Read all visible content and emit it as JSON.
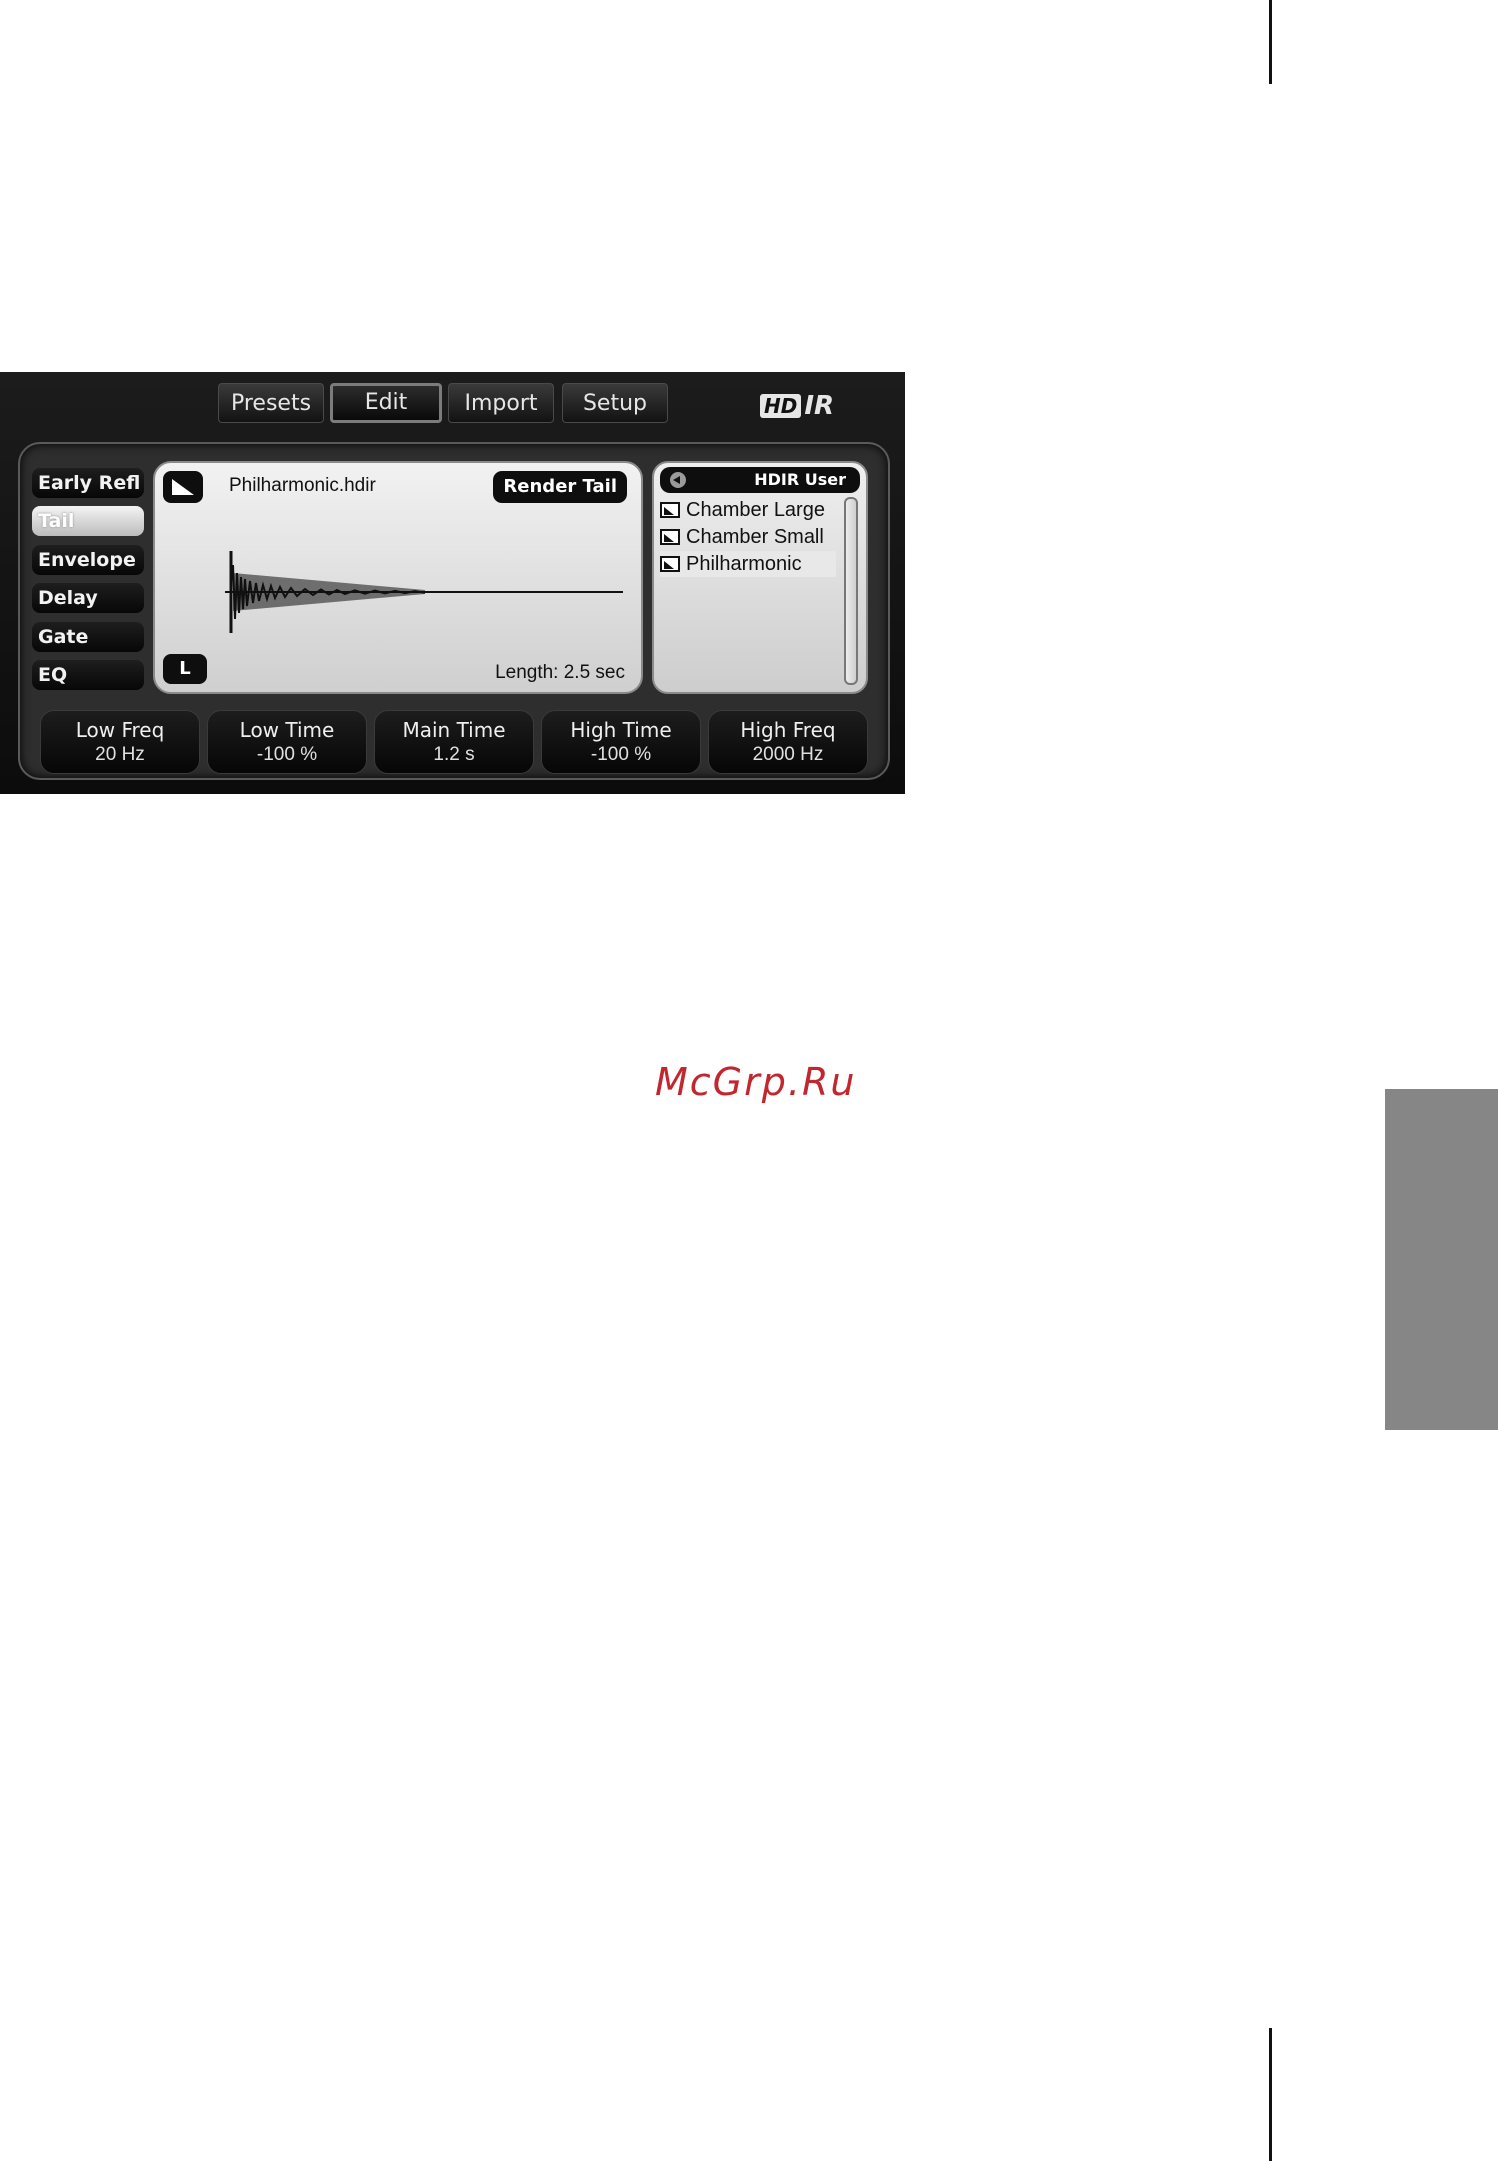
{
  "toolbar": {
    "tabs": [
      {
        "label": "Presets"
      },
      {
        "label": "Edit"
      },
      {
        "label": "Import"
      },
      {
        "label": "Setup"
      }
    ],
    "logo_hd": "HD",
    "logo_ir": "IR"
  },
  "side_nav": {
    "items": [
      {
        "label": "Early Refl"
      },
      {
        "label": "Tail"
      },
      {
        "label": "Envelope"
      },
      {
        "label": "Delay"
      },
      {
        "label": "Gate"
      },
      {
        "label": "EQ"
      }
    ],
    "selected": "Tail"
  },
  "waveform": {
    "filename": "Philharmonic.hdir",
    "render_button": "Render Tail",
    "channel_button": "L",
    "length_text": "Length: 2.5 sec"
  },
  "browser": {
    "title": "HDIR User",
    "items": [
      {
        "label": "Chamber Large"
      },
      {
        "label": "Chamber Small"
      },
      {
        "label": "Philharmonic"
      }
    ],
    "selected": "Philharmonic"
  },
  "knobs": [
    {
      "label": "Low Freq",
      "value": "20 Hz"
    },
    {
      "label": "Low Time",
      "value": "-100 %"
    },
    {
      "label": "Main Time",
      "value": "1.2 s"
    },
    {
      "label": "High Time",
      "value": "-100 %"
    },
    {
      "label": "High Freq",
      "value": "2000 Hz"
    }
  ],
  "watermark": "McGrp.Ru",
  "colors": {
    "watermark": "#c2262e",
    "side_tab": "#868686",
    "panel_bg": "#2e2e2e"
  }
}
